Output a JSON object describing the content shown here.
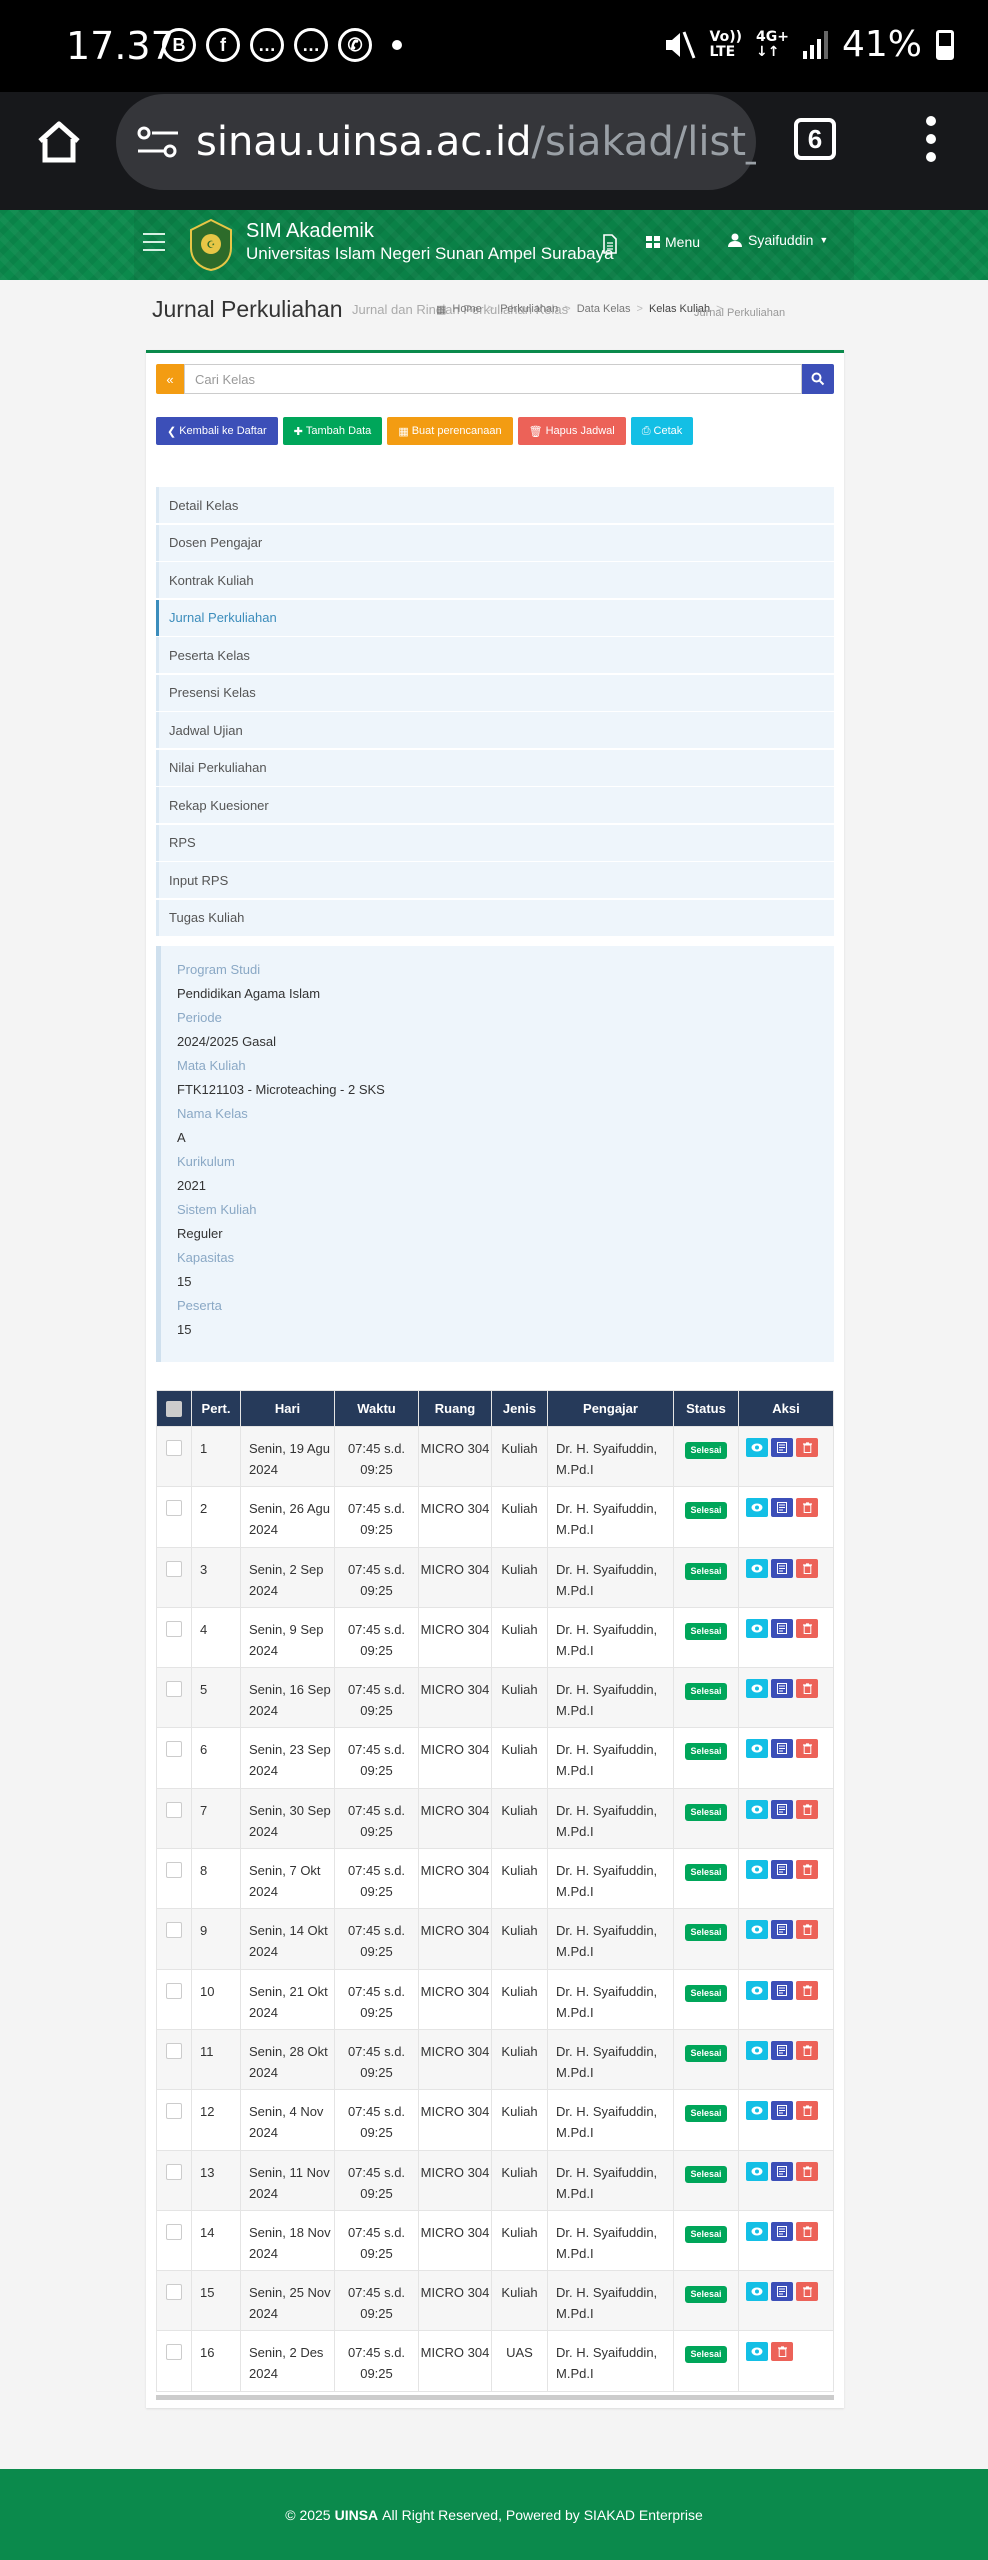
{
  "status_bar": {
    "time": "17.37",
    "net_top": "Vo)) ",
    "net_bottom": "LTE",
    "gen_top": "4G+",
    "gen_bottom": "↓↑",
    "battery": "41%"
  },
  "browser": {
    "url_host": "sinau.uinsa.ac.id",
    "url_path": "/siakad/list_per",
    "tab_count": "6"
  },
  "header": {
    "app_title": "SIM Akademik",
    "university": "Universitas Islam Negeri Sunan Ampel Surabaya",
    "menu_label": "Menu",
    "user_name": "Syaifuddin"
  },
  "page": {
    "title": "Jurnal Perkuliahan",
    "subtitle": "Jurnal dan Rincian Perkuliahan Kelas"
  },
  "breadcrumb": [
    "Home",
    "Perkuliahan",
    "Data Kelas",
    "Kelas Kuliah",
    "Jurnal Perkuliahan"
  ],
  "search": {
    "placeholder": "Cari Kelas"
  },
  "buttons": {
    "back": "Kembali ke Daftar",
    "add": "Tambah Data",
    "plan": "Buat perencanaan",
    "delete_schedule": "Hapus Jadwal",
    "print": "Cetak"
  },
  "nav": [
    {
      "label": "Detail Kelas"
    },
    {
      "label": "Dosen Pengajar"
    },
    {
      "label": "Kontrak Kuliah"
    },
    {
      "label": "Jurnal Perkuliahan",
      "active": true
    },
    {
      "label": "Peserta Kelas"
    },
    {
      "label": "Presensi Kelas"
    },
    {
      "label": "Jadwal Ujian"
    },
    {
      "label": "Nilai Perkuliahan"
    },
    {
      "label": "Rekap Kuesioner"
    },
    {
      "label": "RPS"
    },
    {
      "label": "Input RPS"
    },
    {
      "label": "Tugas Kuliah"
    }
  ],
  "info": [
    {
      "label": "Program Studi",
      "value": "Pendidikan Agama Islam"
    },
    {
      "label": "Periode",
      "value": "2024/2025 Gasal"
    },
    {
      "label": "Mata Kuliah",
      "value": "FTK121103 - Microteaching  - 2 SKS"
    },
    {
      "label": "Nama Kelas",
      "value": "A"
    },
    {
      "label": "Kurikulum",
      "value": "2021"
    },
    {
      "label": "Sistem Kuliah",
      "value": "Reguler"
    },
    {
      "label": "Kapasitas",
      "value": "15"
    },
    {
      "label": "Peserta",
      "value": "15"
    }
  ],
  "table": {
    "headers": [
      "Pert.",
      "Hari",
      "Waktu",
      "Ruang",
      "Jenis",
      "Pengajar",
      "Status",
      "Aksi"
    ],
    "rows": [
      {
        "pert": "1",
        "hari": "Senin, 19 Agu 2024",
        "waktu": "07:45 s.d. 09:25",
        "ruang": "MICRO 304",
        "jenis": "Kuliah",
        "pengajar": "Dr. H. Syaifuddin, M.Pd.I",
        "status": "Selesai"
      },
      {
        "pert": "2",
        "hari": "Senin, 26 Agu 2024",
        "waktu": "07:45 s.d. 09:25",
        "ruang": "MICRO 304",
        "jenis": "Kuliah",
        "pengajar": "Dr. H. Syaifuddin, M.Pd.I",
        "status": "Selesai"
      },
      {
        "pert": "3",
        "hari": "Senin, 2 Sep 2024",
        "waktu": "07:45 s.d. 09:25",
        "ruang": "MICRO 304",
        "jenis": "Kuliah",
        "pengajar": "Dr. H. Syaifuddin, M.Pd.I",
        "status": "Selesai"
      },
      {
        "pert": "4",
        "hari": "Senin, 9 Sep 2024",
        "waktu": "07:45 s.d. 09:25",
        "ruang": "MICRO 304",
        "jenis": "Kuliah",
        "pengajar": "Dr. H. Syaifuddin, M.Pd.I",
        "status": "Selesai"
      },
      {
        "pert": "5",
        "hari": "Senin, 16 Sep 2024",
        "waktu": "07:45 s.d. 09:25",
        "ruang": "MICRO 304",
        "jenis": "Kuliah",
        "pengajar": "Dr. H. Syaifuddin, M.Pd.I",
        "status": "Selesai"
      },
      {
        "pert": "6",
        "hari": "Senin, 23 Sep 2024",
        "waktu": "07:45 s.d. 09:25",
        "ruang": "MICRO 304",
        "jenis": "Kuliah",
        "pengajar": "Dr. H. Syaifuddin, M.Pd.I",
        "status": "Selesai"
      },
      {
        "pert": "7",
        "hari": "Senin, 30 Sep 2024",
        "waktu": "07:45 s.d. 09:25",
        "ruang": "MICRO 304",
        "jenis": "Kuliah",
        "pengajar": "Dr. H. Syaifuddin, M.Pd.I",
        "status": "Selesai"
      },
      {
        "pert": "8",
        "hari": "Senin, 7 Okt 2024",
        "waktu": "07:45 s.d. 09:25",
        "ruang": "MICRO 304",
        "jenis": "Kuliah",
        "pengajar": "Dr. H. Syaifuddin, M.Pd.I",
        "status": "Selesai"
      },
      {
        "pert": "9",
        "hari": "Senin, 14 Okt 2024",
        "waktu": "07:45 s.d. 09:25",
        "ruang": "MICRO 304",
        "jenis": "Kuliah",
        "pengajar": "Dr. H. Syaifuddin, M.Pd.I",
        "status": "Selesai"
      },
      {
        "pert": "10",
        "hari": "Senin, 21 Okt 2024",
        "waktu": "07:45 s.d. 09:25",
        "ruang": "MICRO 304",
        "jenis": "Kuliah",
        "pengajar": "Dr. H. Syaifuddin, M.Pd.I",
        "status": "Selesai"
      },
      {
        "pert": "11",
        "hari": "Senin, 28 Okt 2024",
        "waktu": "07:45 s.d. 09:25",
        "ruang": "MICRO 304",
        "jenis": "Kuliah",
        "pengajar": "Dr. H. Syaifuddin, M.Pd.I",
        "status": "Selesai"
      },
      {
        "pert": "12",
        "hari": "Senin, 4 Nov 2024",
        "waktu": "07:45 s.d. 09:25",
        "ruang": "MICRO 304",
        "jenis": "Kuliah",
        "pengajar": "Dr. H. Syaifuddin, M.Pd.I",
        "status": "Selesai"
      },
      {
        "pert": "13",
        "hari": "Senin, 11 Nov 2024",
        "waktu": "07:45 s.d. 09:25",
        "ruang": "MICRO 304",
        "jenis": "Kuliah",
        "pengajar": "Dr. H. Syaifuddin, M.Pd.I",
        "status": "Selesai"
      },
      {
        "pert": "14",
        "hari": "Senin, 18 Nov 2024",
        "waktu": "07:45 s.d. 09:25",
        "ruang": "MICRO 304",
        "jenis": "Kuliah",
        "pengajar": "Dr. H. Syaifuddin, M.Pd.I",
        "status": "Selesai"
      },
      {
        "pert": "15",
        "hari": "Senin, 25 Nov 2024",
        "waktu": "07:45 s.d. 09:25",
        "ruang": "MICRO 304",
        "jenis": "Kuliah",
        "pengajar": "Dr. H. Syaifuddin, M.Pd.I",
        "status": "Selesai"
      },
      {
        "pert": "16",
        "hari": "Senin, 2 Des 2024",
        "waktu": "07:45 s.d. 09:25",
        "ruang": "MICRO 304",
        "jenis": "UAS",
        "pengajar": "Dr. H. Syaifuddin, M.Pd.I",
        "status": "Selesai",
        "no_edit": true
      }
    ]
  },
  "footer": {
    "prefix": "© 2025",
    "brand": "UINSA",
    "suffix": "All Right Reserved, Powered by SIAKAD Enterprise"
  },
  "colors": {
    "header_green": "#0b8a4c",
    "table_header": "#263a5a",
    "status_green": "#00a65a",
    "primary_blue": "#3c4fb8"
  }
}
